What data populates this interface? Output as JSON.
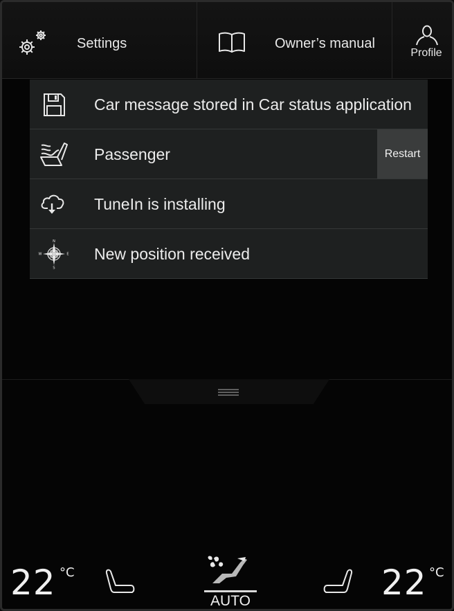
{
  "topbar": {
    "settings_label": "Settings",
    "settings_icon": "gear-icon",
    "manual_label": "Owner’s manual",
    "manual_icon": "book-icon",
    "profile_label": "Profile",
    "profile_icon": "person-icon"
  },
  "notifications": [
    {
      "icon": "floppy-disk-icon",
      "text": "Car message stored in Car status application"
    },
    {
      "icon": "heated-seat-icon",
      "text": "Passenger",
      "action": "Restart"
    },
    {
      "icon": "cloud-download-icon",
      "text": "TuneIn is installing"
    },
    {
      "icon": "compass-icon",
      "text": "New position received",
      "compass_letters": [
        "N",
        "E",
        "S",
        "W"
      ]
    }
  ],
  "climate": {
    "left_temp": "22",
    "left_unit": "°C",
    "right_temp": "22",
    "right_unit": "°C",
    "auto_label": "AUTO",
    "left_seat_icon": "seat-icon",
    "right_seat_icon": "seat-icon",
    "fan_icon": "fan-airflow-icon"
  },
  "colors": {
    "background": "#050505",
    "notification_bg": "#1e2020",
    "button_bg": "#3a3c3c",
    "text": "#ececec"
  }
}
